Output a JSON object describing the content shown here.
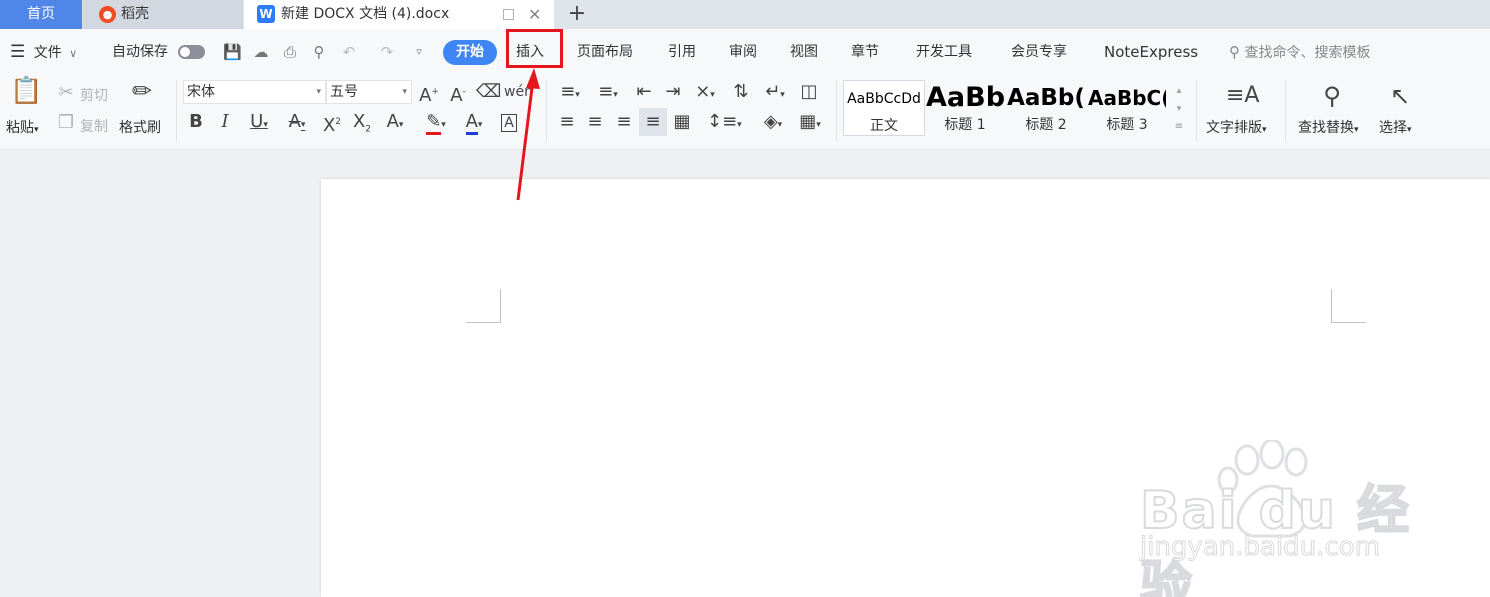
{
  "tabs": {
    "home": "首页",
    "daoke": "稻壳",
    "doc": "新建 DOCX 文档 (4).docx"
  },
  "menu": {
    "file": "文件",
    "autosave": "自动保存",
    "items": [
      "开始",
      "插入",
      "页面布局",
      "引用",
      "审阅",
      "视图",
      "章节",
      "开发工具",
      "会员专享",
      "NoteExpress"
    ],
    "search_placeholder": "查找命令、搜索模板"
  },
  "ribbon": {
    "paste": "粘贴",
    "cut": "剪切",
    "copy": "复制",
    "format_painter": "格式刷",
    "font_name": "宋体",
    "font_size": "五号",
    "styles": [
      {
        "preview": "AaBbCcDd",
        "name": "正文"
      },
      {
        "preview": "AaBb",
        "name": "标题 1"
      },
      {
        "preview": "AaBb(",
        "name": "标题 2"
      },
      {
        "preview": "AaBbC(",
        "name": "标题 3"
      }
    ],
    "text_layout": "文字排版",
    "find_replace": "查找替换",
    "select": "选择"
  },
  "colors": {
    "accent": "#3f86f5",
    "highlight_box": "#e5161d",
    "arrow": "#e5161d",
    "home_tab": "#4f86e8"
  },
  "watermark": {
    "brand": "Bai du 经验",
    "url": "jingyan.baidu.com"
  }
}
